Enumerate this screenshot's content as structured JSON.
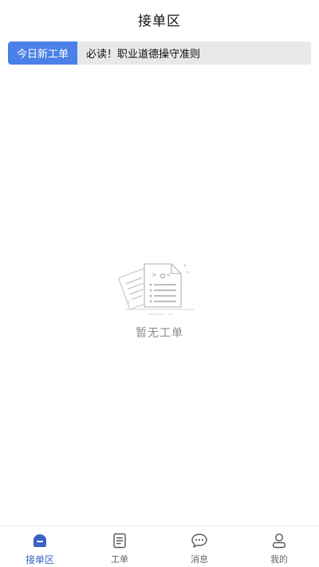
{
  "header": {
    "title": "接单区"
  },
  "notice": {
    "tag": "今日新工单",
    "text": "必读！职业道德操守准则"
  },
  "empty_state": {
    "icon": "empty-document-icon",
    "text": "暂无工单"
  },
  "tabbar": {
    "active_color": "#3a63c4",
    "items": [
      {
        "label": "接单区",
        "icon": "home-icon",
        "active": true
      },
      {
        "label": "工单",
        "icon": "document-icon",
        "active": false
      },
      {
        "label": "消息",
        "icon": "chat-bubble-icon",
        "active": false
      },
      {
        "label": "我的",
        "icon": "user-icon",
        "active": false
      }
    ]
  }
}
